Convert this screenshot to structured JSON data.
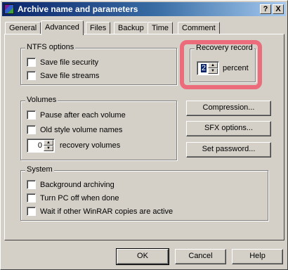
{
  "window": {
    "title": "Archive name and parameters",
    "help_button": "?",
    "close_button": "X"
  },
  "tabs": [
    "General",
    "Advanced",
    "Files",
    "Backup",
    "Time",
    "Comment"
  ],
  "active_tab": "Advanced",
  "ntfs": {
    "legend": "NTFS options",
    "save_security": "Save file security",
    "save_streams": "Save file streams"
  },
  "recovery": {
    "legend": "Recovery record",
    "value": "2",
    "unit": "percent"
  },
  "volumes": {
    "legend": "Volumes",
    "pause": "Pause after each volume",
    "old_style": "Old style volume names",
    "recovery_value": "0",
    "recovery_label": "recovery volumes"
  },
  "side_buttons": {
    "compression": "Compression...",
    "sfx": "SFX options...",
    "password": "Set password..."
  },
  "system": {
    "legend": "System",
    "background": "Background archiving",
    "turn_off": "Turn PC off when done",
    "wait": "Wait if other WinRAR copies are active"
  },
  "footer": {
    "ok": "OK",
    "cancel": "Cancel",
    "help": "Help"
  },
  "colors": {
    "dialog_bg": "#d4d0c8",
    "title_start": "#0a246a",
    "title_end": "#a6caf0",
    "highlight": "#f05a6e"
  }
}
